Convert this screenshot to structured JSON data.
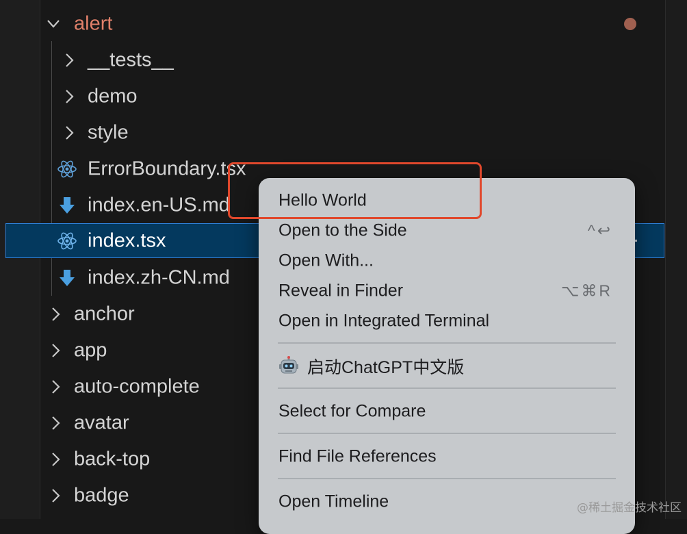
{
  "explorer": {
    "tree": [
      {
        "label": "alert",
        "kind": "folder-open",
        "level": 0,
        "modified": true
      },
      {
        "label": "__tests__",
        "kind": "folder",
        "level": 1
      },
      {
        "label": "demo",
        "kind": "folder",
        "level": 1
      },
      {
        "label": "style",
        "kind": "folder",
        "level": 1
      },
      {
        "label": "ErrorBoundary.tsx",
        "kind": "react-file",
        "level": 1
      },
      {
        "label": "index.en-US.md",
        "kind": "markdown-file",
        "level": 1
      },
      {
        "label": "index.tsx",
        "kind": "react-file",
        "level": 1,
        "selected": true
      },
      {
        "label": "index.zh-CN.md",
        "kind": "markdown-file",
        "level": 1
      },
      {
        "label": "anchor",
        "kind": "folder",
        "level": 0
      },
      {
        "label": "app",
        "kind": "folder",
        "level": 0
      },
      {
        "label": "auto-complete",
        "kind": "folder",
        "level": 0
      },
      {
        "label": "avatar",
        "kind": "folder",
        "level": 0
      },
      {
        "label": "back-top",
        "kind": "folder",
        "level": 0
      },
      {
        "label": "badge",
        "kind": "folder",
        "level": 0
      }
    ]
  },
  "context_menu": {
    "items": [
      {
        "label": "Hello World",
        "shortcut": ""
      },
      {
        "label": "Open to the Side",
        "shortcut": "^↩"
      },
      {
        "label": "Open With...",
        "shortcut": ""
      },
      {
        "label": "Reveal in Finder",
        "shortcut": "⌥⌘R"
      },
      {
        "label": "Open in Integrated Terminal",
        "shortcut": ""
      },
      {
        "label": "启动ChatGPT中文版",
        "shortcut": "",
        "icon": "robot-icon"
      },
      {
        "label": "Select for Compare",
        "shortcut": ""
      },
      {
        "label": "Find File References",
        "shortcut": ""
      },
      {
        "label": "Open Timeline",
        "shortcut": ""
      }
    ]
  },
  "highlight": {
    "color": "#e0482c",
    "target": "Hello World"
  },
  "watermark": "@稀土掘金技术社区",
  "colors": {
    "background": "#181818",
    "selection": "#04395e",
    "selection_border": "#2f7fd6",
    "folder_modified": "#e0806a",
    "react_icon": "#5fa0d8",
    "markdown_icon": "#4a9fe0",
    "menu_bg": "#c6c9cc"
  }
}
